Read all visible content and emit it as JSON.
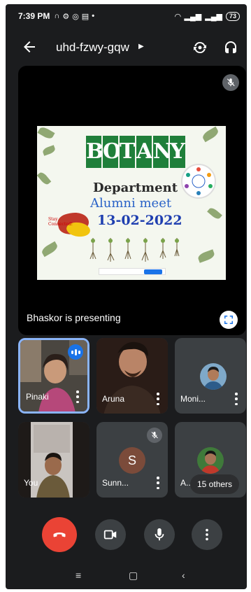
{
  "status_bar": {
    "time": "7:39 PM",
    "battery": "73"
  },
  "header": {
    "meeting_code": "uhd-fzwy-gqw"
  },
  "presentation": {
    "slide": {
      "title_letters": [
        "B",
        "O",
        "T",
        "A",
        "N",
        "Y"
      ],
      "department": "Department",
      "event": "Alumni meet",
      "date": "13-02-2022",
      "badge": "Stay Connected!"
    },
    "presenting_label": "Bhaskor is presenting"
  },
  "participants": [
    {
      "name": "Pinaki",
      "speaking": true
    },
    {
      "name": "Aruna"
    },
    {
      "name": "Moni..."
    },
    {
      "name": "You"
    },
    {
      "name": "Sunn...",
      "avatar_letter": "S",
      "muted": true
    },
    {
      "name": "A..."
    }
  ],
  "others_chip": "15 others",
  "colors": {
    "background": "#1b1c1e",
    "tile": "#3c4043",
    "end_call": "#ea4335",
    "accent": "#8ab4f8",
    "slide_green": "#1f7f3a"
  },
  "icons": {
    "back": "arrow-left-icon",
    "switch_camera": "switch-camera-icon",
    "audio": "headset-icon",
    "end_call": "phone-hangup-icon",
    "camera": "video-camera-icon",
    "mic": "microphone-icon",
    "more": "more-vertical-icon"
  }
}
